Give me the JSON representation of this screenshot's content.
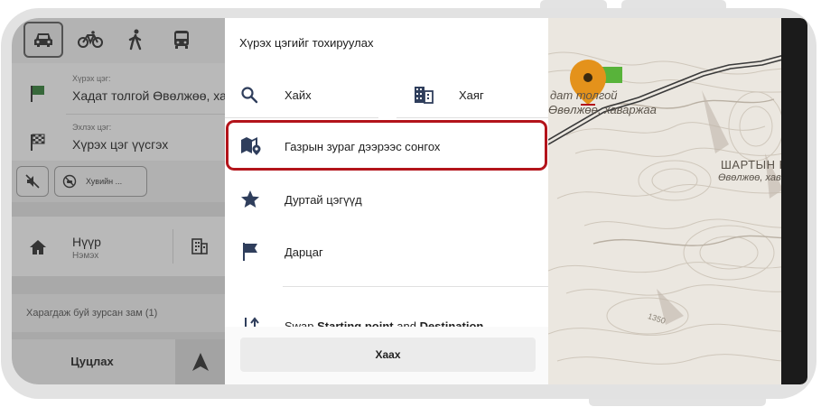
{
  "planner": {
    "modes": [
      {
        "icon": "car-icon",
        "active": true
      },
      {
        "icon": "bicycle-icon",
        "active": false
      },
      {
        "icon": "walking-icon",
        "active": false
      },
      {
        "icon": "bus-icon",
        "active": false
      }
    ],
    "destination": {
      "label": "Хүрэх цэг:",
      "value": "Хадат толгой Өвөлжөө, хаваржаа"
    },
    "start": {
      "label": "Эхлэх цэг:",
      "value": "Хүрэх цэг үүсгэх"
    },
    "options": {
      "mute_icon": "volume-off-icon",
      "custom_label": "Хувийн ..."
    },
    "home": {
      "title": "Нүүр",
      "subtitle": "Нэмэх"
    },
    "saved_routes": "Харагдаж буй зурсан зам (1)",
    "cancel_label": "Цуцлах"
  },
  "sheet": {
    "title": "Хүрэх цэгийг тохируулах",
    "search_label": "Хайх",
    "address_label": "Хаяг",
    "select_on_map_label": "Газрын зураг дээрээс сонгох",
    "favorites_label": "Дуртай цэгүүд",
    "markers_label": "Дарцаг",
    "swap": {
      "prefix": "Swap ",
      "start": "Starting point",
      "middle": " and ",
      "destination": "Destination"
    },
    "close_label": "Хаах"
  },
  "map": {
    "place_1_line_1": "дат толгой",
    "place_1_line_2": "Өвөлжөө, хаваржаа",
    "place_2_line_1": "ШАРТЫН Н",
    "place_2_line_2": "Өвөлжөө, хав",
    "elevation_label": "1350",
    "pin_color": "#e4921b",
    "flag_color": "#58b33a"
  },
  "colors": {
    "highlight": "#b3141b"
  }
}
